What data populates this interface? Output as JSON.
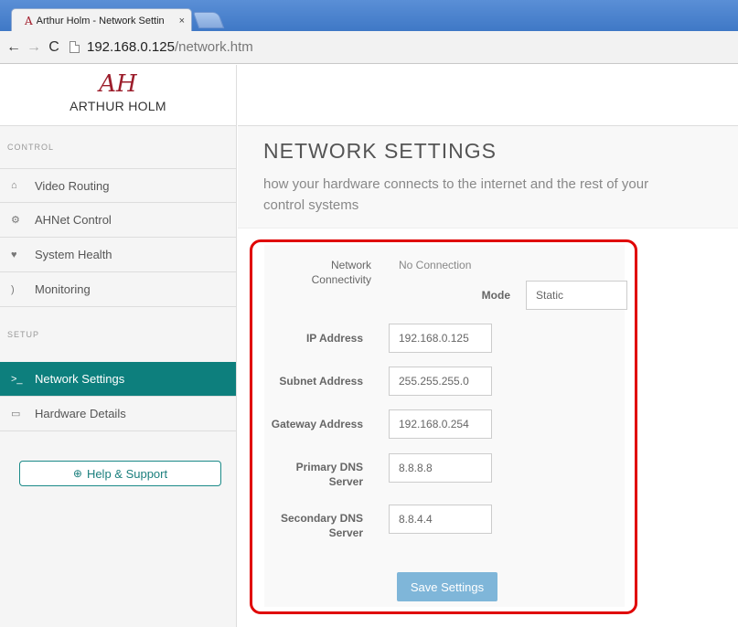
{
  "browser": {
    "tab_title": "Arthur Holm - Network Settin",
    "tab_close": "×",
    "url_host": "192.168.0.125",
    "url_path": "/network.htm"
  },
  "sidebar": {
    "logo_mark": "AH",
    "brand": "ARTHUR HOLM",
    "section_control": "CONTROL",
    "control_items": [
      {
        "label": "Video Routing",
        "icon": "home-icon"
      },
      {
        "label": "AHNet Control",
        "icon": "gears-icon"
      },
      {
        "label": "System Health",
        "icon": "heart-icon"
      },
      {
        "label": "Monitoring",
        "icon": "rss-icon"
      }
    ],
    "section_setup": "SETUP",
    "setup_items": [
      {
        "label": "Network Settings",
        "icon": "terminal-icon",
        "active": true
      },
      {
        "label": "Hardware Details",
        "icon": "hdd-icon"
      }
    ],
    "help_label": "Help & Support"
  },
  "header": {
    "title": "NETWORK SETTINGS",
    "subtitle": "how your hardware connects to the internet and the rest of your control systems"
  },
  "form": {
    "connectivity_label": "Network Connectivity",
    "connectivity_value": "No Connection",
    "mode_label": "Mode",
    "mode_value": "Static",
    "ip_label": "IP Address",
    "ip_value": "192.168.0.125",
    "subnet_label": "Subnet Address",
    "subnet_value": "255.255.255.0",
    "gateway_label": "Gateway Address",
    "gateway_value": "192.168.0.254",
    "dns1_label": "Primary DNS Server",
    "dns1_value": "8.8.8.8",
    "dns2_label": "Secondary DNS Server",
    "dns2_value": "8.8.4.4",
    "save_label": "Save Settings"
  },
  "colors": {
    "accent": "#0d7f7d",
    "brand": "#9c1d2b",
    "highlight_border": "#e00000",
    "save_button": "#7fb6d9"
  }
}
